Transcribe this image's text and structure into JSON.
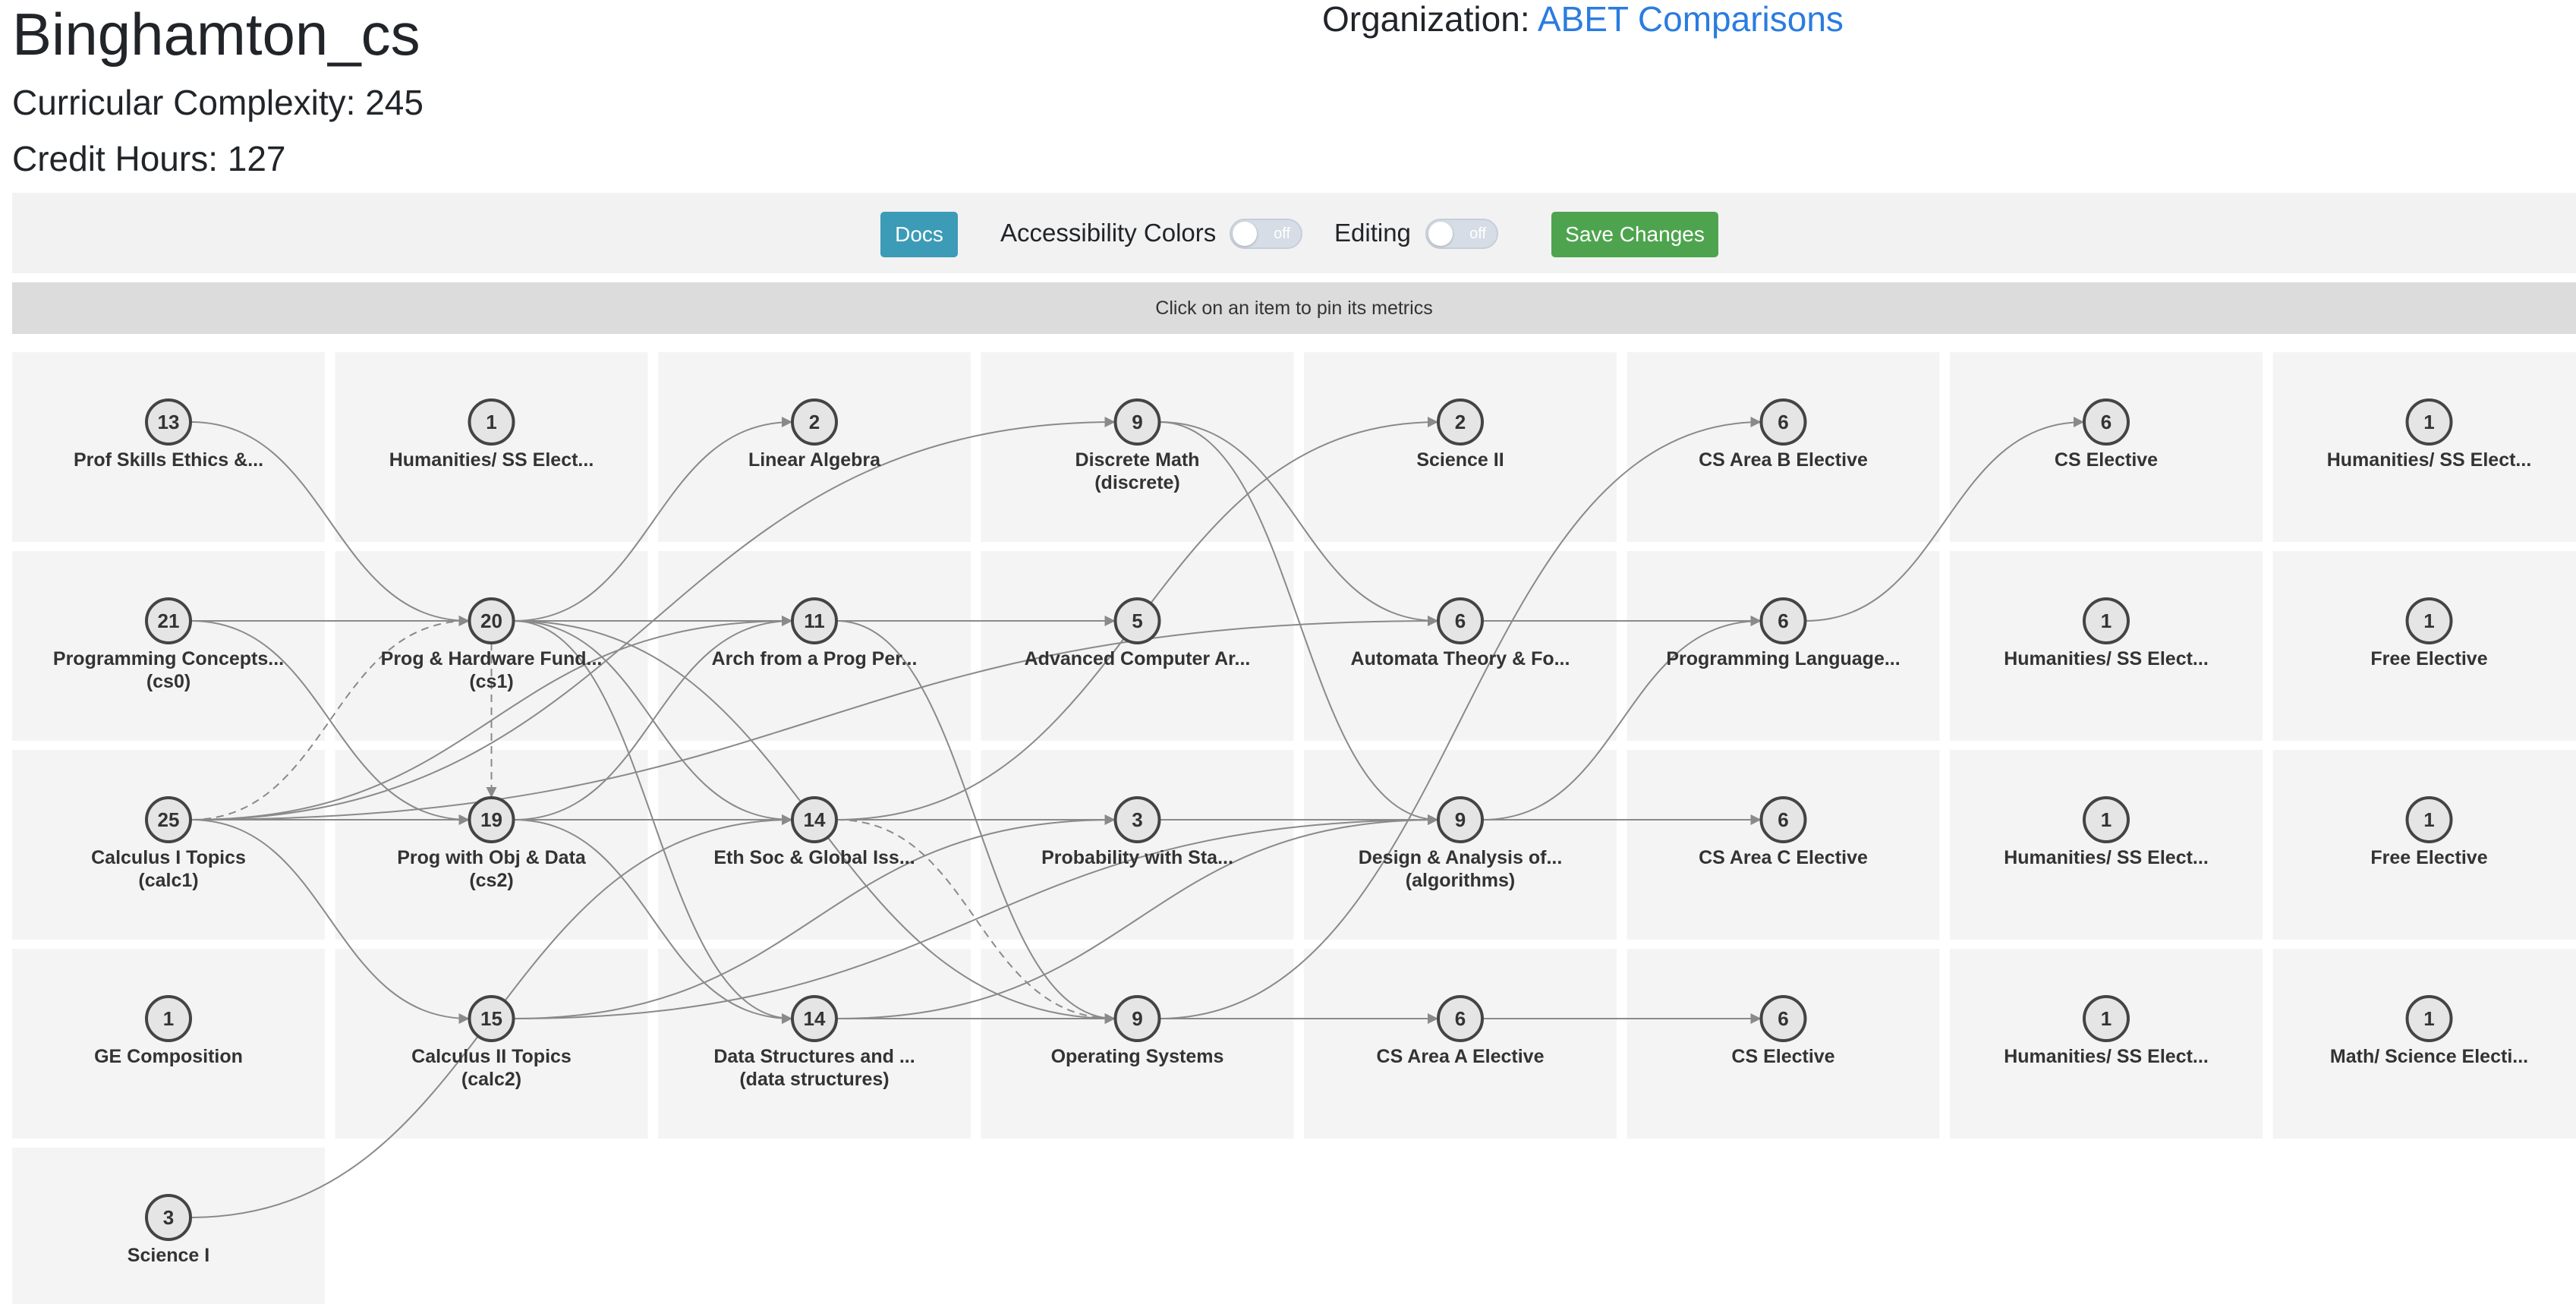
{
  "header": {
    "title": "Binghamton_cs",
    "complexity": "Curricular Complexity: 245",
    "credits": "Credit Hours: 127",
    "org_prefix": "Organization: ",
    "org_link": "ABET Comparisons"
  },
  "toolbar": {
    "docs": "Docs",
    "accessibility_label": "Accessibility Colors",
    "accessibility_state": "off",
    "editing_label": "Editing",
    "editing_state": "off",
    "save": "Save Changes"
  },
  "info_text": "Click on an item to pin its metrics",
  "colors": {
    "link": "#2a7ce0",
    "docs_button": "#3c9bb7",
    "save_button": "#4ea44e",
    "edge": "#8a8a8a",
    "node_fill": "#e5e5e5"
  },
  "courses": [
    {
      "id": "prof",
      "num": "13",
      "lines": [
        "Prof Skills Ethics &..."
      ],
      "term": 1,
      "row": 1
    },
    {
      "id": "prog-concepts",
      "num": "21",
      "lines": [
        "Programming Concepts...",
        "(cs0)"
      ],
      "term": 1,
      "row": 2
    },
    {
      "id": "calc1",
      "num": "25",
      "lines": [
        "Calculus I Topics",
        "(calc1)"
      ],
      "term": 1,
      "row": 3
    },
    {
      "id": "gecomp",
      "num": "1",
      "lines": [
        "GE Composition"
      ],
      "term": 1,
      "row": 4
    },
    {
      "id": "sci1",
      "num": "3",
      "lines": [
        "Science I"
      ],
      "term": 1,
      "row": 5
    },
    {
      "id": "hum-2a",
      "num": "1",
      "lines": [
        "Humanities/ SS Elect..."
      ],
      "term": 2,
      "row": 1
    },
    {
      "id": "cs1",
      "num": "20",
      "lines": [
        "Prog & Hardware Fund...",
        "(cs1)"
      ],
      "term": 2,
      "row": 2
    },
    {
      "id": "cs2",
      "num": "19",
      "lines": [
        "Prog with Obj & Data",
        "(cs2)"
      ],
      "term": 2,
      "row": 3
    },
    {
      "id": "calc2",
      "num": "15",
      "lines": [
        "Calculus II Topics",
        "(calc2)"
      ],
      "term": 2,
      "row": 4
    },
    {
      "id": "linalg",
      "num": "2",
      "lines": [
        "Linear Algebra"
      ],
      "term": 3,
      "row": 1
    },
    {
      "id": "arch",
      "num": "11",
      "lines": [
        "Arch from a Prog Per..."
      ],
      "term": 3,
      "row": 2
    },
    {
      "id": "ethsoc",
      "num": "14",
      "lines": [
        "Eth Soc & Global Iss..."
      ],
      "term": 3,
      "row": 3
    },
    {
      "id": "ds",
      "num": "14",
      "lines": [
        "Data Structures and ...",
        "(data structures)"
      ],
      "term": 3,
      "row": 4
    },
    {
      "id": "discrete",
      "num": "9",
      "lines": [
        "Discrete Math",
        "(discrete)"
      ],
      "term": 4,
      "row": 1
    },
    {
      "id": "advarch",
      "num": "5",
      "lines": [
        "Advanced Computer Ar..."
      ],
      "term": 4,
      "row": 2
    },
    {
      "id": "prob",
      "num": "3",
      "lines": [
        "Probability with Sta..."
      ],
      "term": 4,
      "row": 3
    },
    {
      "id": "os",
      "num": "9",
      "lines": [
        "Operating Systems"
      ],
      "term": 4,
      "row": 4
    },
    {
      "id": "sci2",
      "num": "2",
      "lines": [
        "Science II"
      ],
      "term": 5,
      "row": 1
    },
    {
      "id": "automata",
      "num": "6",
      "lines": [
        "Automata Theory & Fo..."
      ],
      "term": 5,
      "row": 2
    },
    {
      "id": "algo",
      "num": "9",
      "lines": [
        "Design & Analysis of...",
        "(algorithms)"
      ],
      "term": 5,
      "row": 3
    },
    {
      "id": "csA",
      "num": "6",
      "lines": [
        "CS Area A Elective"
      ],
      "term": 5,
      "row": 4
    },
    {
      "id": "csB",
      "num": "6",
      "lines": [
        "CS Area B Elective"
      ],
      "term": 6,
      "row": 1
    },
    {
      "id": "proglang",
      "num": "6",
      "lines": [
        "Programming Language..."
      ],
      "term": 6,
      "row": 2
    },
    {
      "id": "csC",
      "num": "6",
      "lines": [
        "CS Area C Elective"
      ],
      "term": 6,
      "row": 3
    },
    {
      "id": "cselec6",
      "num": "6",
      "lines": [
        "CS Elective"
      ],
      "term": 6,
      "row": 4
    },
    {
      "id": "cselec7",
      "num": "6",
      "lines": [
        "CS Elective"
      ],
      "term": 7,
      "row": 1
    },
    {
      "id": "hum-7b",
      "num": "1",
      "lines": [
        "Humanities/ SS Elect..."
      ],
      "term": 7,
      "row": 2
    },
    {
      "id": "hum-7c",
      "num": "1",
      "lines": [
        "Humanities/ SS Elect..."
      ],
      "term": 7,
      "row": 3
    },
    {
      "id": "hum-7d",
      "num": "1",
      "lines": [
        "Humanities/ SS Elect..."
      ],
      "term": 7,
      "row": 4
    },
    {
      "id": "hum-8a",
      "num": "1",
      "lines": [
        "Humanities/ SS Elect..."
      ],
      "term": 8,
      "row": 1
    },
    {
      "id": "free-8b",
      "num": "1",
      "lines": [
        "Free Elective"
      ],
      "term": 8,
      "row": 2
    },
    {
      "id": "free-8c",
      "num": "1",
      "lines": [
        "Free Elective"
      ],
      "term": 8,
      "row": 3
    },
    {
      "id": "mathsci",
      "num": "1",
      "lines": [
        "Math/ Science Electi..."
      ],
      "term": 8,
      "row": 4
    }
  ],
  "edges": [
    {
      "from": "prof",
      "to": "cs1"
    },
    {
      "from": "prog-concepts",
      "to": "cs1"
    },
    {
      "from": "prog-concepts",
      "to": "cs2"
    },
    {
      "from": "calc1",
      "to": "cs1",
      "dashed": true
    },
    {
      "from": "calc1",
      "to": "cs2"
    },
    {
      "from": "calc1",
      "to": "calc2"
    },
    {
      "from": "calc1",
      "to": "arch"
    },
    {
      "from": "calc1",
      "to": "discrete"
    },
    {
      "from": "calc1",
      "to": "automata"
    },
    {
      "from": "cs1",
      "to": "cs2",
      "dashed": true
    },
    {
      "from": "cs1",
      "to": "linalg"
    },
    {
      "from": "cs1",
      "to": "arch"
    },
    {
      "from": "cs1",
      "to": "ethsoc"
    },
    {
      "from": "cs1",
      "to": "ds"
    },
    {
      "from": "cs1",
      "to": "os"
    },
    {
      "from": "cs2",
      "to": "arch"
    },
    {
      "from": "cs2",
      "to": "ethsoc"
    },
    {
      "from": "cs2",
      "to": "ds"
    },
    {
      "from": "cs2",
      "to": "algo"
    },
    {
      "from": "calc2",
      "to": "prob"
    },
    {
      "from": "calc2",
      "to": "algo"
    },
    {
      "from": "arch",
      "to": "advarch"
    },
    {
      "from": "arch",
      "to": "os"
    },
    {
      "from": "ethsoc",
      "to": "sci2"
    },
    {
      "from": "ethsoc",
      "to": "os",
      "dashed": true
    },
    {
      "from": "ethsoc",
      "to": "algo",
      "dashed": true
    },
    {
      "from": "ds",
      "to": "os"
    },
    {
      "from": "ds",
      "to": "algo"
    },
    {
      "from": "sci1",
      "to": "ethsoc"
    },
    {
      "from": "discrete",
      "to": "automata"
    },
    {
      "from": "discrete",
      "to": "algo"
    },
    {
      "from": "os",
      "to": "csA"
    },
    {
      "from": "os",
      "to": "cselec6"
    },
    {
      "from": "os",
      "to": "csB"
    },
    {
      "from": "automata",
      "to": "proglang"
    },
    {
      "from": "algo",
      "to": "proglang"
    },
    {
      "from": "algo",
      "to": "csC"
    },
    {
      "from": "proglang",
      "to": "cselec7"
    }
  ]
}
